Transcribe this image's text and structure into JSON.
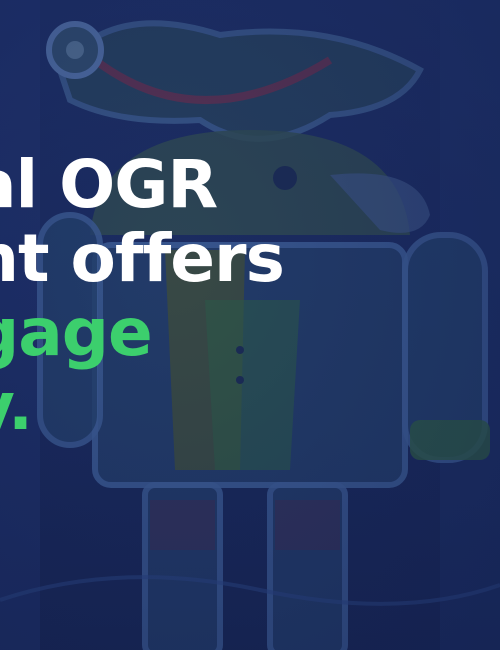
{
  "headline": {
    "lines": [
      {
        "text": "al OGR",
        "accent": false
      },
      {
        "text": "nt offers",
        "accent": false
      },
      {
        "text": "gage",
        "accent": true
      },
      {
        "text": "y.",
        "accent": true
      }
    ]
  },
  "colors": {
    "background": "#1c2d63",
    "text": "#ffffff",
    "accent": "#3ccf6d"
  },
  "background_image": {
    "subject": "android-pirate-mascot-illustration"
  }
}
